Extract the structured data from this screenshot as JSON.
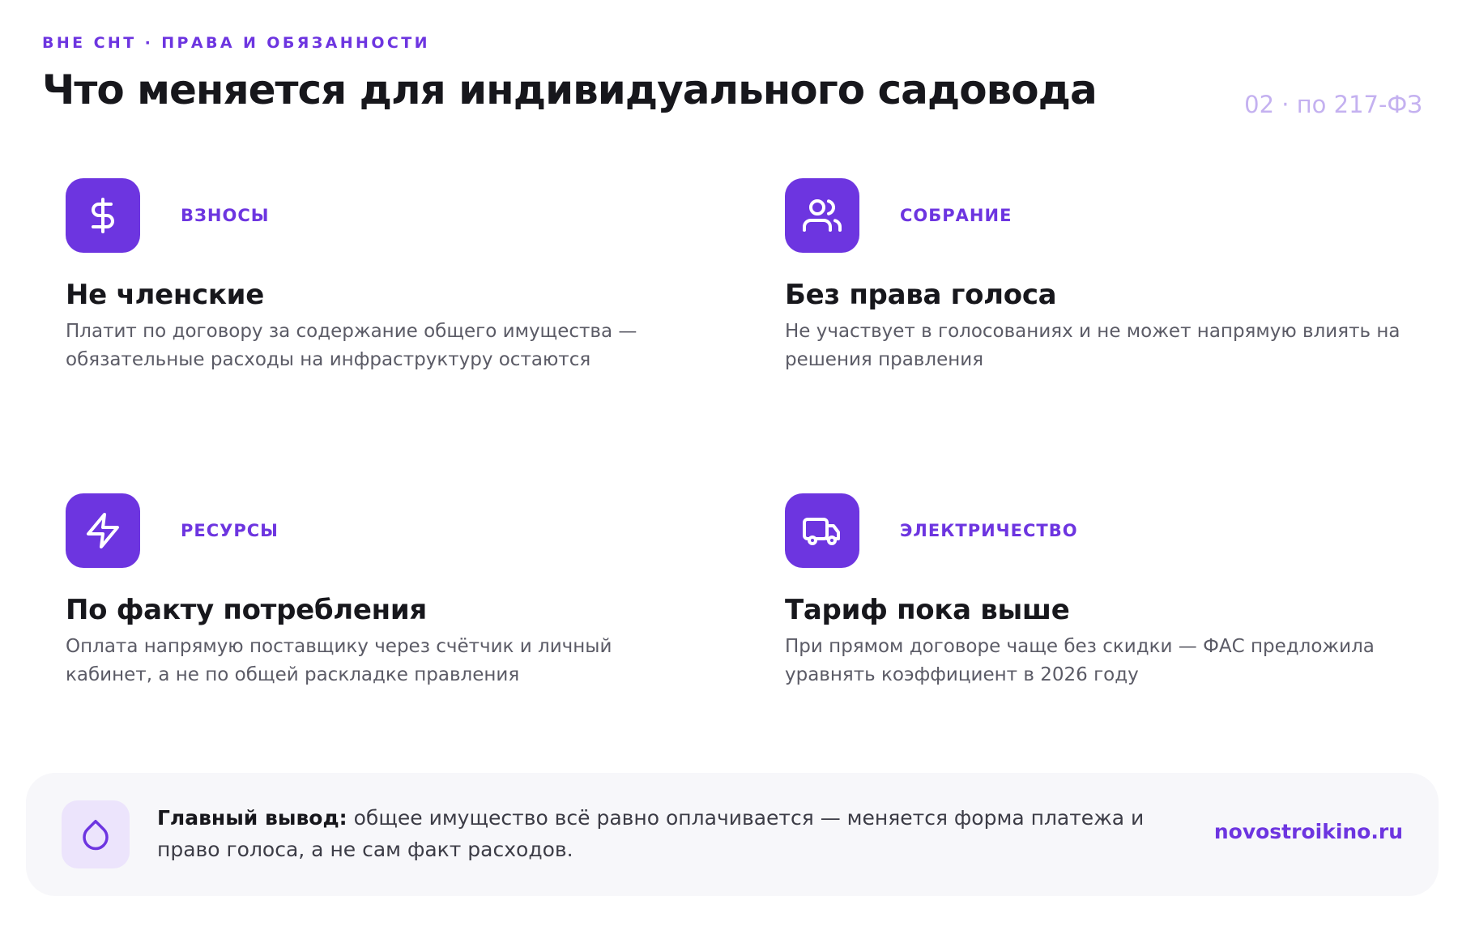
{
  "header": {
    "eyebrow": "ВНЕ СНТ · ПРАВА И ОБЯЗАННОСТИ",
    "title": "Что меняется для индивидуального садовода",
    "page_number": "02 · по 217-ФЗ"
  },
  "cards": [
    {
      "icon": "dollar-icon",
      "tag": "ВЗНОСЫ",
      "heading": "Не членские",
      "text": "Платит по договору за содержание общего имущества — обязательные расходы на инфраструктуру остаются"
    },
    {
      "icon": "users-icon",
      "tag": "СОБРАНИЕ",
      "heading": "Без права голоса",
      "text": "Не участвует в голосованиях и не может напрямую влиять на решения правления"
    },
    {
      "icon": "lightning-icon",
      "tag": "РЕСУРСЫ",
      "heading": "По факту потребления",
      "text": "Оплата напрямую поставщику через счётчик и личный кабинет, а не по общей раскладке правления"
    },
    {
      "icon": "truck-icon",
      "tag": "ЭЛЕКТРИЧЕСТВО",
      "heading": "Тариф пока выше",
      "text": "При прямом договоре чаще без скидки — ФАС предложила уравнять коэффициент в 2026 году"
    }
  ],
  "summary": {
    "icon": "droplet-icon",
    "label": "Главный вывод:",
    "text": " общее имущество всё равно оплачивается — меняется форма платежа и право голоса, а не сам факт расходов."
  },
  "footer": {
    "site": "novostroikino.ru"
  },
  "colors": {
    "accent": "#6d35e0",
    "accent_light": "#ece4fc",
    "page_number": "#c4b1f0",
    "summary_bg": "#f7f7fa"
  }
}
